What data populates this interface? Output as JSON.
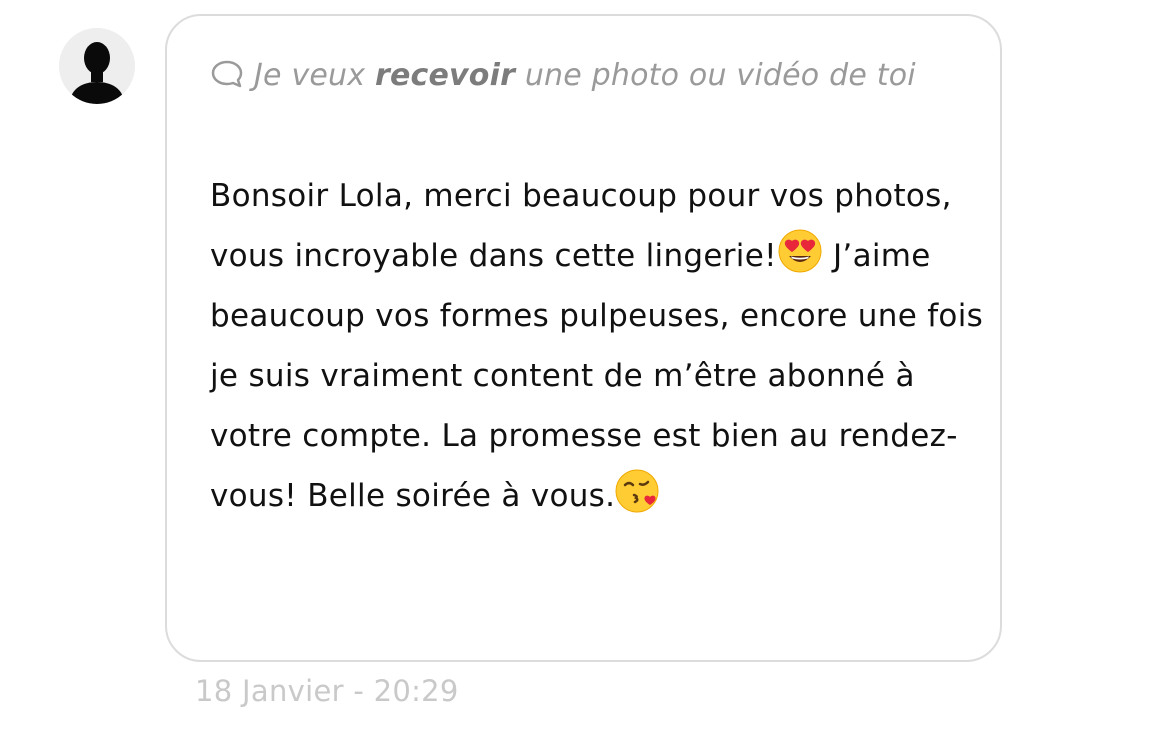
{
  "sender": {
    "avatar_icon": "person-silhouette-icon"
  },
  "message": {
    "request": {
      "icon": "chat-bubble-icon",
      "prefix": "Je veux ",
      "bold_word": "recevoir",
      "suffix": " une photo ou vidéo de toi"
    },
    "body_part1": "Bonsoir Lola, merci beaucoup pour vos photos, vous incroyable dans cette lingerie!",
    "emoji1": "heart-eyes-emoji",
    "body_part2": " J’aime beaucoup vos formes pulpeuses, encore une fois je suis vraiment content de m’être abonné à votre compte. La promesse est bien au rendez-vous! Belle soirée à vous.",
    "emoji2": "kissing-heart-emoji",
    "timestamp": "18 Janvier - 20:29"
  },
  "colors": {
    "bubble_border": "#dcdcdc",
    "request_text": "#9a9a9a",
    "body_text": "#111111",
    "timestamp": "#c9c9c9"
  }
}
